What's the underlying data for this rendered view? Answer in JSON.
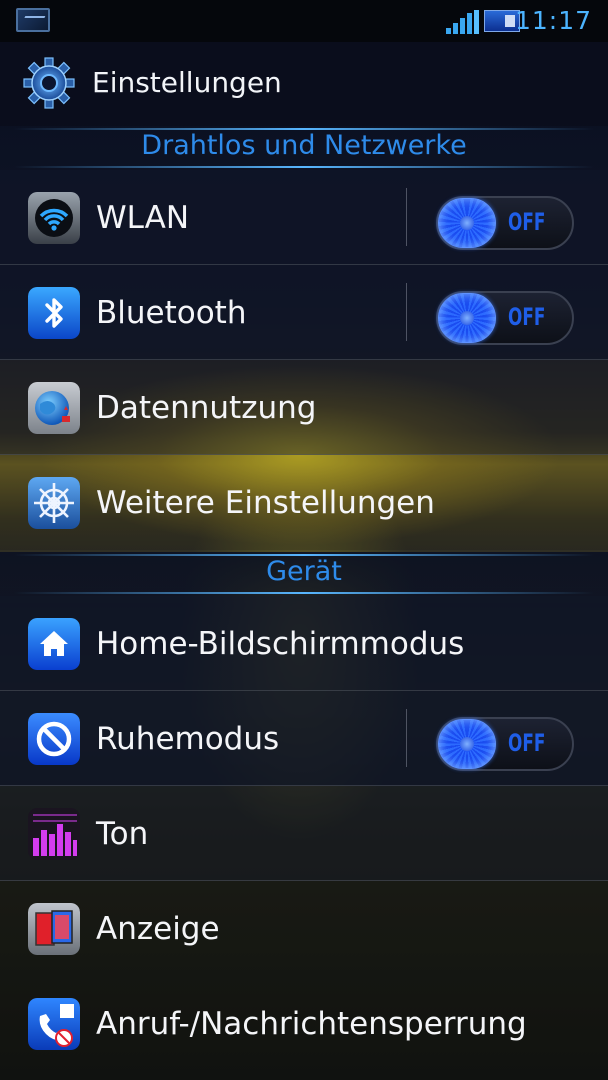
{
  "status_bar": {
    "time": "11:17",
    "left_icon": "landscape-notification-icon",
    "signal_icon": "cell-signal-icon",
    "battery_icon": "battery-icon",
    "accent_color": "#4cb4ff"
  },
  "action_bar": {
    "title": "Einstellungen",
    "icon": "settings-gear-icon"
  },
  "sections": [
    {
      "label": "Drahtlos und Netzwerke"
    },
    {
      "label": "Gerät"
    }
  ],
  "items": [
    {
      "label": "WLAN",
      "icon": "wifi-icon",
      "toggle": "OFF"
    },
    {
      "label": "Bluetooth",
      "icon": "bluetooth-icon",
      "toggle": "OFF"
    },
    {
      "label": "Datennutzung",
      "icon": "globe-data-icon"
    },
    {
      "label": "Weitere Einstellungen",
      "icon": "wheel-icon"
    },
    {
      "label": "Home-Bildschirmmodus",
      "icon": "home-icon"
    },
    {
      "label": "Ruhemodus",
      "icon": "block-icon",
      "toggle": "OFF"
    },
    {
      "label": "Ton",
      "icon": "equalizer-icon"
    },
    {
      "label": "Anzeige",
      "icon": "display-icon"
    },
    {
      "label": "Anruf-/Nachrichtensperrung",
      "icon": "call-block-icon"
    }
  ],
  "colors": {
    "section_header_text": "#2e8bea",
    "toggle_knob": "#2c6aff",
    "toggle_off_text": "#1f5ee8"
  }
}
